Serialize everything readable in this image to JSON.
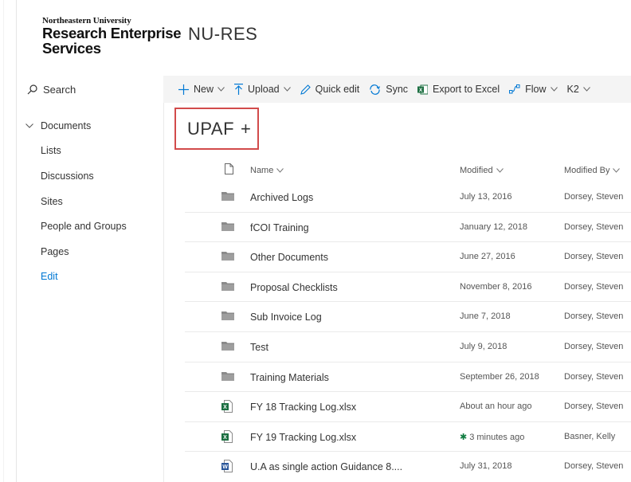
{
  "logo": {
    "line1": "Northeastern University",
    "line2": "Research Enterprise",
    "line3": "Services"
  },
  "site_title": "NU-RES",
  "search": {
    "label": "Search"
  },
  "commands": {
    "new": "New",
    "upload": "Upload",
    "quick_edit": "Quick edit",
    "sync": "Sync",
    "export": "Export to Excel",
    "flow": "Flow",
    "k2": "K2"
  },
  "nav": {
    "documents": "Documents",
    "items": [
      "Lists",
      "Discussions",
      "Sites",
      "People and Groups",
      "Pages"
    ],
    "edit": "Edit"
  },
  "library": {
    "title": "UPAF",
    "plus": "+"
  },
  "columns": {
    "name": "Name",
    "modified": "Modified",
    "modified_by": "Modified By"
  },
  "rows": [
    {
      "type": "folder",
      "name": "Archived Logs",
      "modified": "July 13, 2016",
      "by": "Dorsey, Steven"
    },
    {
      "type": "folder",
      "name": "fCOI Training",
      "modified": "January 12, 2018",
      "by": "Dorsey, Steven"
    },
    {
      "type": "folder",
      "name": "Other Documents",
      "modified": "June 27, 2016",
      "by": "Dorsey, Steven"
    },
    {
      "type": "folder",
      "name": "Proposal Checklists",
      "modified": "November 8, 2016",
      "by": "Dorsey, Steven"
    },
    {
      "type": "folder",
      "name": "Sub Invoice Log",
      "modified": "June 7, 2018",
      "by": "Dorsey, Steven"
    },
    {
      "type": "folder",
      "name": "Test",
      "modified": "July 9, 2018",
      "by": "Dorsey, Steven"
    },
    {
      "type": "folder",
      "name": "Training Materials",
      "modified": "September 26, 2018",
      "by": "Dorsey, Steven"
    },
    {
      "type": "excel",
      "name": "FY 18 Tracking Log.xlsx",
      "modified": "About an hour ago",
      "by": "Dorsey, Steven"
    },
    {
      "type": "excel",
      "name": "FY 19 Tracking Log.xlsx",
      "modified": "3 minutes ago",
      "new_marker": "✱",
      "by": "Basner, Kelly"
    },
    {
      "type": "word",
      "name": "U.A as single action Guidance 8....",
      "modified": "July 31, 2018",
      "by": "Dorsey, Steven"
    }
  ],
  "colors": {
    "accent": "#0078d4",
    "highlight_box": "#d24b4b",
    "excel": "#1d6f42",
    "word": "#2b579a",
    "folder": "#8a8a8a"
  }
}
